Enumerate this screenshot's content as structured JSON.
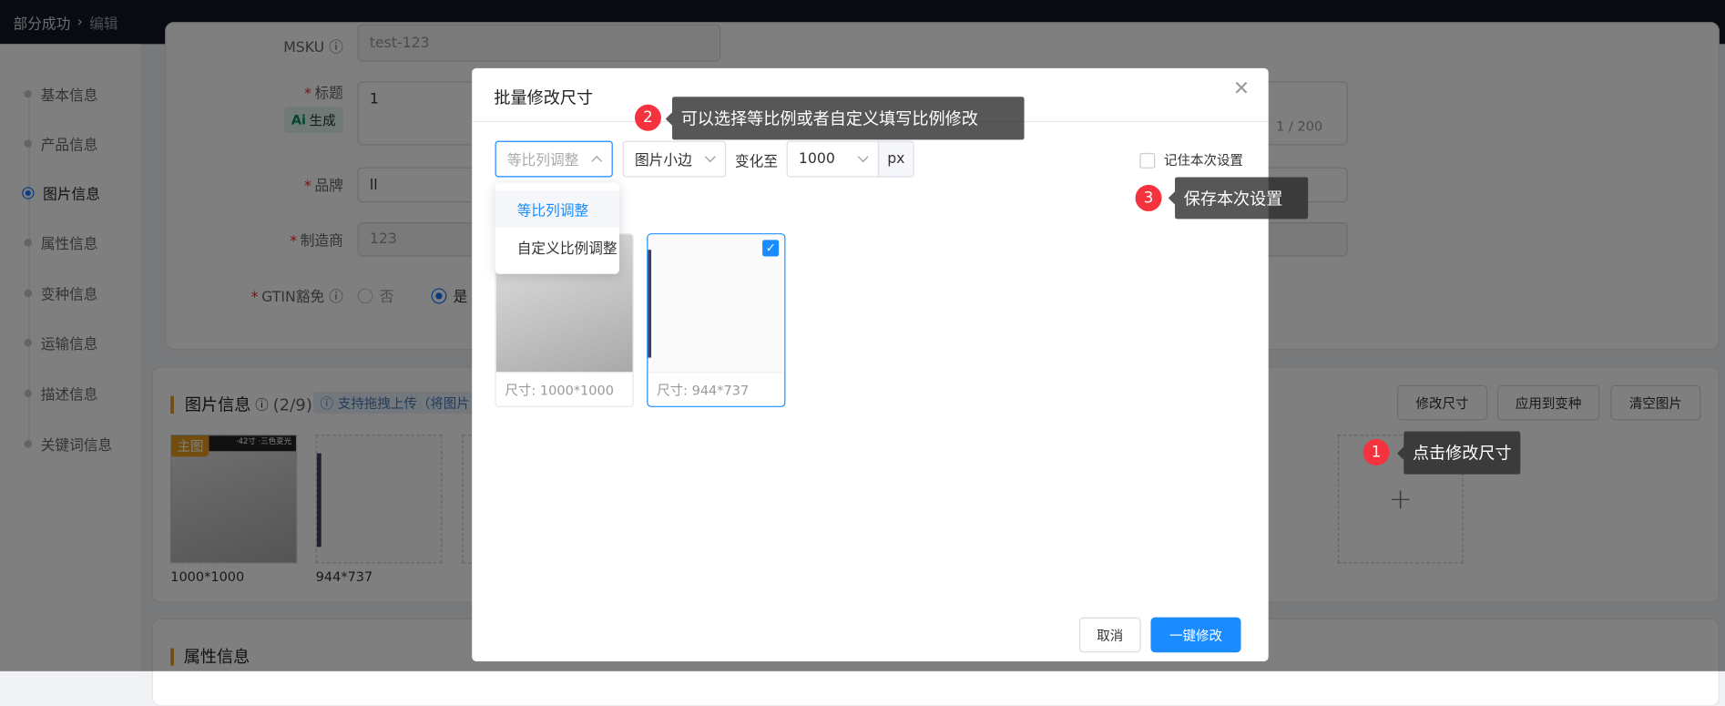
{
  "topbar": {
    "breadcrumb": [
      "部分成功",
      "编辑"
    ]
  },
  "sidebar": {
    "items": [
      {
        "label": "基本信息"
      },
      {
        "label": "产品信息"
      },
      {
        "label": "图片信息",
        "active": true
      },
      {
        "label": "属性信息"
      },
      {
        "label": "变种信息"
      },
      {
        "label": "运输信息"
      },
      {
        "label": "描述信息"
      },
      {
        "label": "关键词信息"
      }
    ]
  },
  "form": {
    "msku_label": "MSKU",
    "msku_value": "test-123",
    "title_label": "标题",
    "title_value": "1",
    "title_count": "1 / 200",
    "ai_button": "生成",
    "brand_label": "品牌",
    "brand_value": "ll",
    "manufacturer_label": "制造商",
    "manufacturer_value": "123",
    "gtin_label": "GTIN豁免",
    "gtin_options": [
      "否",
      "是"
    ],
    "gtin_selected": "是"
  },
  "images_section": {
    "title": "图片信息",
    "count": "(2/9)",
    "hint": "支持拖拽上传（将图片",
    "buttons": {
      "resize": "修改尺寸",
      "apply_variants": "应用到变种",
      "clear": "清空图片"
    },
    "main_tag": "主图",
    "main_image_text": "·42寸 ·三色变光",
    "images": [
      {
        "size": "1000*1000"
      },
      {
        "size": "944*737"
      }
    ]
  },
  "attributes_section": {
    "title": "属性信息"
  },
  "modal": {
    "title": "批量修改尺寸",
    "mode_select": {
      "value": "等比列调整",
      "options": [
        "等比列调整",
        "自定义比例调整"
      ],
      "highlighted": "等比列调整"
    },
    "side_select": {
      "value": "图片小边"
    },
    "change_to_label": "变化至",
    "size_select": {
      "value": "1000"
    },
    "unit": "px",
    "remember_label": "记住本次设置",
    "images": [
      {
        "caption": "尺寸: 1000*1000",
        "checked": false
      },
      {
        "caption": "尺寸: 944*737",
        "checked": true
      }
    ],
    "cancel": "取消",
    "confirm": "一键修改"
  },
  "annotations": [
    {
      "num": "1",
      "text": "点击修改尺寸"
    },
    {
      "num": "2",
      "text": "可以选择等比例或者自定义填写比例修改"
    },
    {
      "num": "3",
      "text": "保存本次设置"
    }
  ],
  "colors": {
    "primary": "#1a8cff",
    "accent": "#f5333f",
    "topbar": "#101722"
  }
}
